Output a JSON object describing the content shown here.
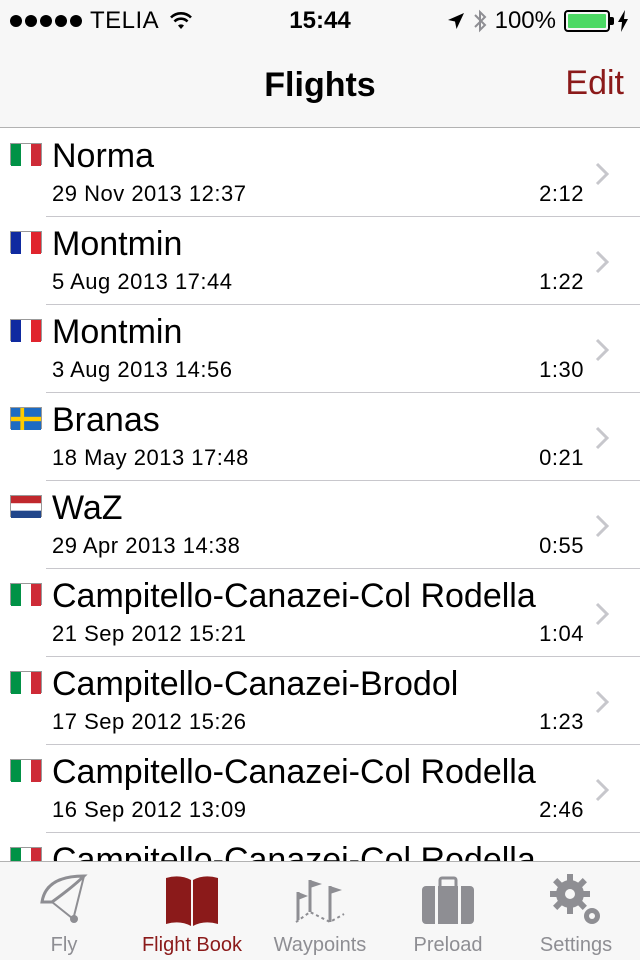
{
  "status_bar": {
    "carrier": "TELIA",
    "time": "15:44",
    "battery": "100%",
    "battery_color": "#4cd964"
  },
  "nav": {
    "title": "Flights",
    "edit_label": "Edit",
    "accent": "#8b1a1a"
  },
  "flights": [
    {
      "name": "Norma",
      "date": "29 Nov 2013 12:37",
      "duration": "2:12",
      "flag": "italy"
    },
    {
      "name": "Montmin",
      "date": "5 Aug 2013 17:44",
      "duration": "1:22",
      "flag": "france"
    },
    {
      "name": "Montmin",
      "date": "3 Aug 2013 14:56",
      "duration": "1:30",
      "flag": "france"
    },
    {
      "name": "Branas",
      "date": "18 May 2013 17:48",
      "duration": "0:21",
      "flag": "sweden"
    },
    {
      "name": "WaZ",
      "date": "29 Apr 2013 14:38",
      "duration": "0:55",
      "flag": "netherlands"
    },
    {
      "name": "Campitello-Canazei-Col Rodella",
      "date": "21 Sep 2012 15:21",
      "duration": "1:04",
      "flag": "italy"
    },
    {
      "name": "Campitello-Canazei-Brodol",
      "date": "17 Sep 2012 15:26",
      "duration": "1:23",
      "flag": "italy"
    },
    {
      "name": "Campitello-Canazei-Col Rodella",
      "date": "16 Sep 2012 13:09",
      "duration": "2:46",
      "flag": "italy"
    },
    {
      "name": "Campitello-Canazei-Col Rodella",
      "date": "",
      "duration": "",
      "flag": "italy"
    }
  ],
  "tabs": [
    {
      "label": "Fly",
      "icon": "paraglider-icon",
      "active": false
    },
    {
      "label": "Flight Book",
      "icon": "book-icon",
      "active": true
    },
    {
      "label": "Waypoints",
      "icon": "waypoint-flags-icon",
      "active": false
    },
    {
      "label": "Preload",
      "icon": "suitcase-icon",
      "active": false
    },
    {
      "label": "Settings",
      "icon": "gears-icon",
      "active": false
    }
  ]
}
